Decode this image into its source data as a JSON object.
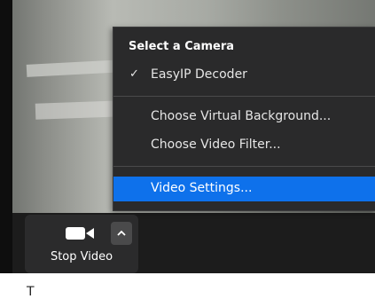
{
  "camera_menu": {
    "header": "Select a Camera",
    "cameras": [
      {
        "label": "EasyIP Decoder",
        "selected": true
      }
    ],
    "options": [
      "Choose Virtual Background...",
      "Choose Video Filter..."
    ],
    "settings_label": "Video Settings..."
  },
  "toolbar": {
    "stop_video_label": "Stop Video",
    "camera_icon": "video-camera-icon",
    "caret_icon": "chevron-up-icon"
  },
  "background_text": "T",
  "colors": {
    "menu_bg": "#2a2a2b",
    "highlight": "#0e71eb",
    "toolbar_bg": "#2b2b2c"
  }
}
